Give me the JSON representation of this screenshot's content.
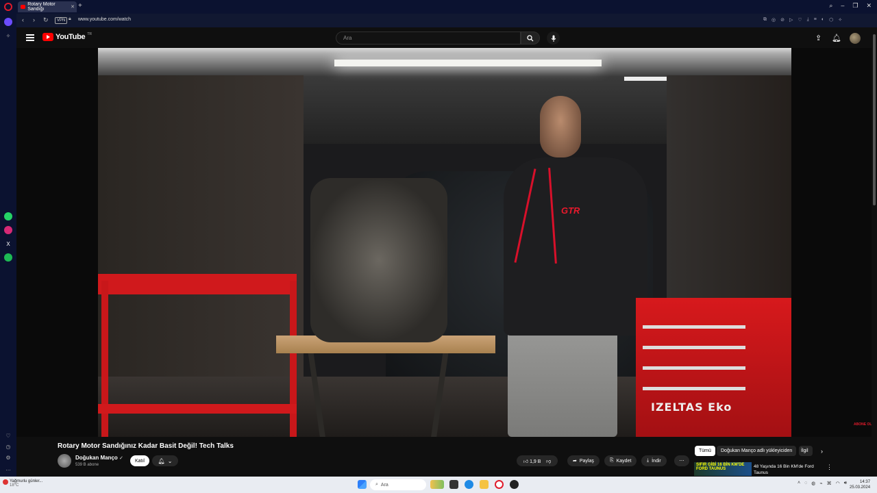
{
  "browser": {
    "tab_title": "Rotary Motor Sandığı",
    "url": "www.youtube.com/watch",
    "vpn_label": "VPN"
  },
  "youtube": {
    "logo_text": "YouTube",
    "logo_region": "TR",
    "search_placeholder": "Ara"
  },
  "video": {
    "title": "Rotary Motor Sandığınız Kadar Basit Değil! Tech Talks",
    "toolbox_brand": "IZELTAS Eko",
    "shirt_logo": "GTR",
    "watermark": "ABONE OL"
  },
  "channel": {
    "name": "Doğukan Manço",
    "subscribers": "539 B abone",
    "join_label": "Katıl"
  },
  "actions": {
    "likes": "1,9 B",
    "share_label": "Paylaş",
    "save_label": "Kaydet",
    "download_label": "İndir"
  },
  "chips": {
    "all": "Tümü",
    "uploader": "Doğukan Manço adlı yükleyiciden",
    "related": "İlgil"
  },
  "recommendation": {
    "thumb_text": "SIFIR GİBİ 16 BİN KM'DE FORD TAUNUS",
    "title": "48 Yaşında 16 Bin KM'de Ford Taunus"
  },
  "taskbar": {
    "weather_line1": "Yağmurlu günler...",
    "weather_line2": "18°C",
    "search_placeholder": "Ara",
    "time": "14:37",
    "date": "25.03.2024"
  }
}
